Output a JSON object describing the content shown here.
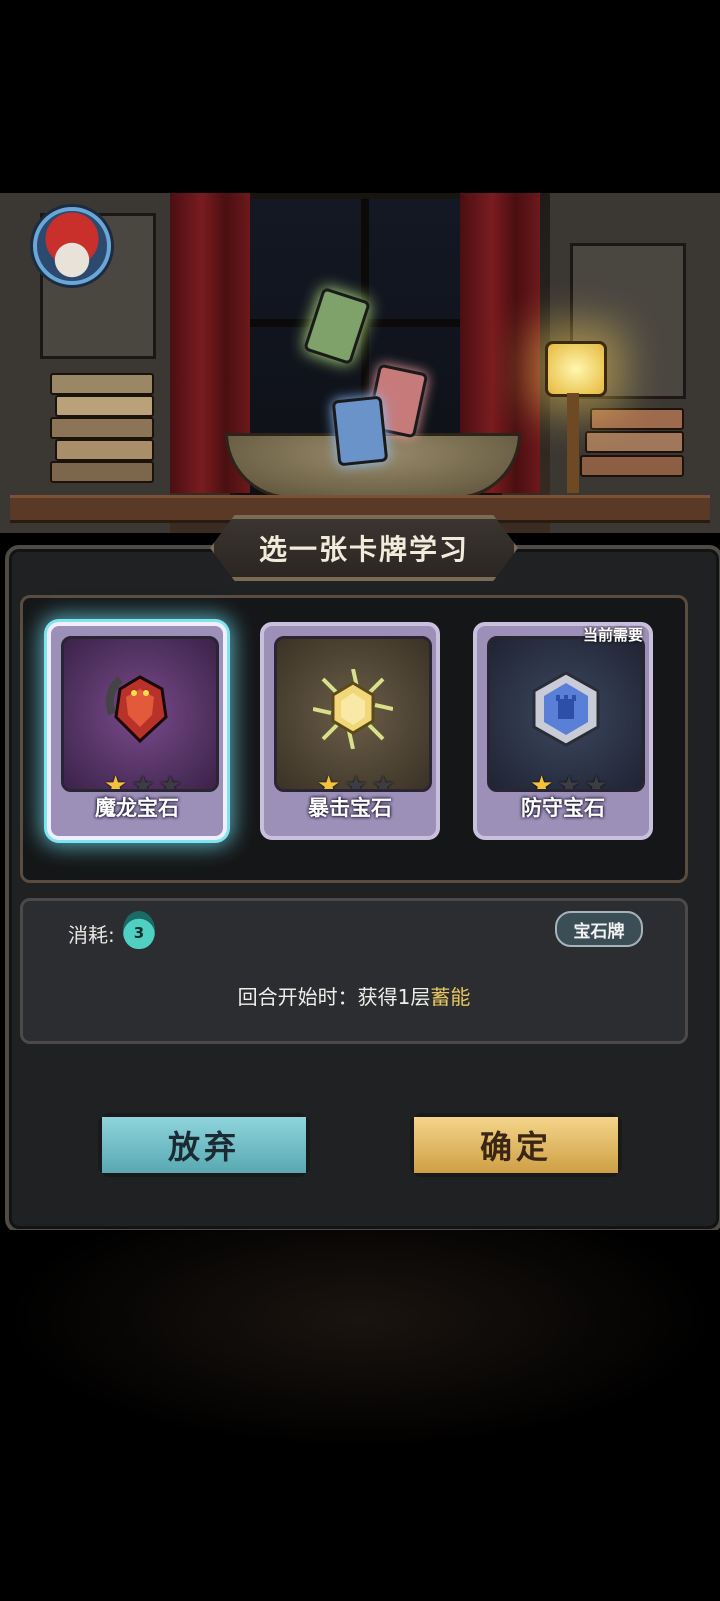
{
  "dialog": {
    "title": "选一张卡牌学习"
  },
  "cards": [
    {
      "name": "魔龙宝石",
      "stars_filled": 1,
      "stars_total": 3,
      "selected": true,
      "tag": "",
      "icon": "dragon-gem-icon",
      "bg": "#5a3b66"
    },
    {
      "name": "暴击宝石",
      "stars_filled": 1,
      "stars_total": 3,
      "selected": false,
      "tag": "",
      "icon": "crit-gem-icon",
      "bg": "#4a4236"
    },
    {
      "name": "防守宝石",
      "stars_filled": 1,
      "stars_total": 3,
      "selected": false,
      "tag": "当前需要",
      "icon": "defense-gem-icon",
      "bg": "#2e3442"
    }
  ],
  "description": {
    "cost_label": "消耗:",
    "cost_value": "3",
    "type_badge": "宝石牌",
    "text_prefix": "回合开始时：获得1层",
    "text_keyword": "蓄能"
  },
  "buttons": {
    "give_up": "放弃",
    "confirm": "确定"
  },
  "colors": {
    "accent_keyword": "#e8c760",
    "selected_glow": "#7fe3f0"
  }
}
